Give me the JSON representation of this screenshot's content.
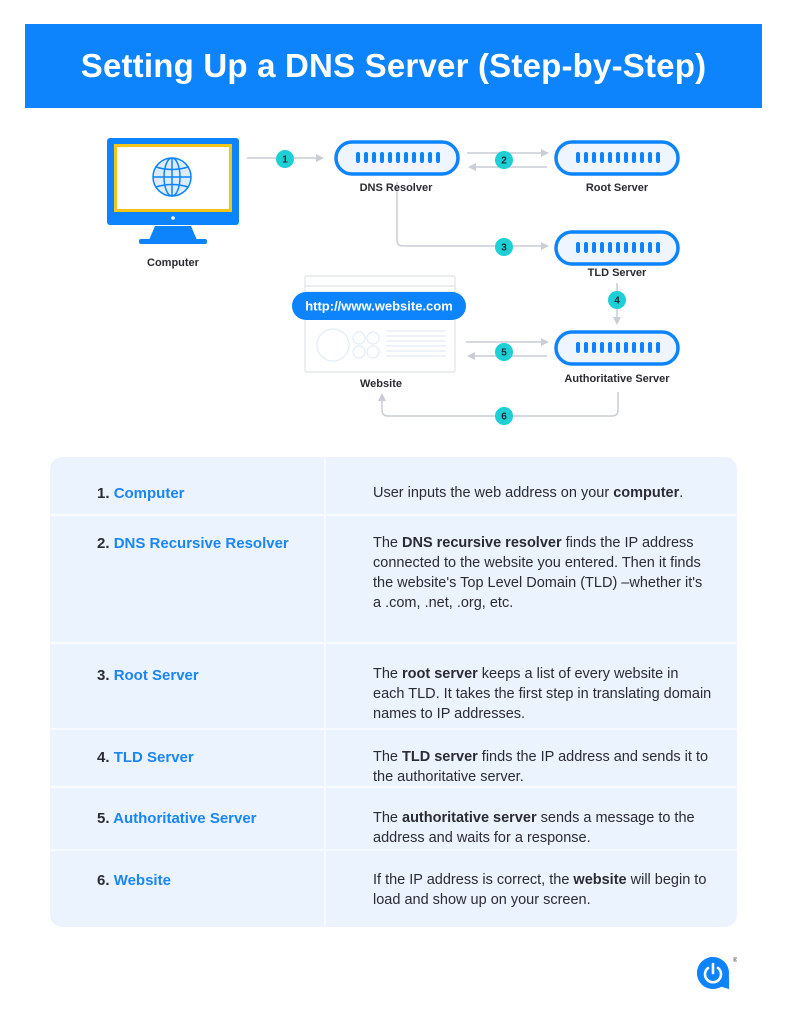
{
  "header": {
    "title": "Setting Up a DNS Server (Step-by-Step)"
  },
  "diagram": {
    "nodes": {
      "computer": "Computer",
      "dns_resolver": "DNS Resolver",
      "root_server": "Root Server",
      "tld_server": "TLD Server",
      "authoritative_server": "Authoritative Server",
      "website": "Website"
    },
    "url_pill": "http://www.website.com",
    "steps": [
      "1",
      "2",
      "3",
      "4",
      "5",
      "6"
    ],
    "colors": {
      "brand": "#0d84fb",
      "badge": "#1fcfd6",
      "connector": "#c9ced6",
      "screen_border": "#f5c518"
    }
  },
  "table": {
    "rows": [
      {
        "num": "1.",
        "term": "Computer",
        "desc": [
          {
            "t": "User inputs the web address on your "
          },
          {
            "b": "computer"
          },
          {
            "t": "."
          }
        ]
      },
      {
        "num": "2.",
        "term": "DNS Recursive Resolver",
        "desc": [
          {
            "t": "The "
          },
          {
            "b": "DNS recursive resolver"
          },
          {
            "t": " finds the IP address connected to the website you entered. Then it finds the website's Top Level Domain (TLD) –whether it's a .com, .net, .org, etc."
          }
        ]
      },
      {
        "num": "3.",
        "term": "Root Server",
        "desc": [
          {
            "t": "The "
          },
          {
            "b": "root server"
          },
          {
            "t": " keeps a list of every website in each TLD. It takes the first step in translating domain names to IP addresses."
          }
        ]
      },
      {
        "num": "4.",
        "term": "TLD Server",
        "desc": [
          {
            "t": "The "
          },
          {
            "b": "TLD server"
          },
          {
            "t": " finds the IP address and sends it to the authoritative server."
          }
        ]
      },
      {
        "num": "5.",
        "term": "Authoritative Server",
        "desc": [
          {
            "t": "The "
          },
          {
            "b": "authoritative server"
          },
          {
            "t": " sends a message to the address and waits for a response."
          }
        ]
      },
      {
        "num": "6.",
        "term": "Website",
        "desc": [
          {
            "t": "If the IP address is correct, the "
          },
          {
            "b": "website"
          },
          {
            "t": " will begin to load and show up on your screen."
          }
        ]
      }
    ]
  },
  "footer": {
    "logo": "power-logo-icon",
    "registered_mark": "®"
  }
}
